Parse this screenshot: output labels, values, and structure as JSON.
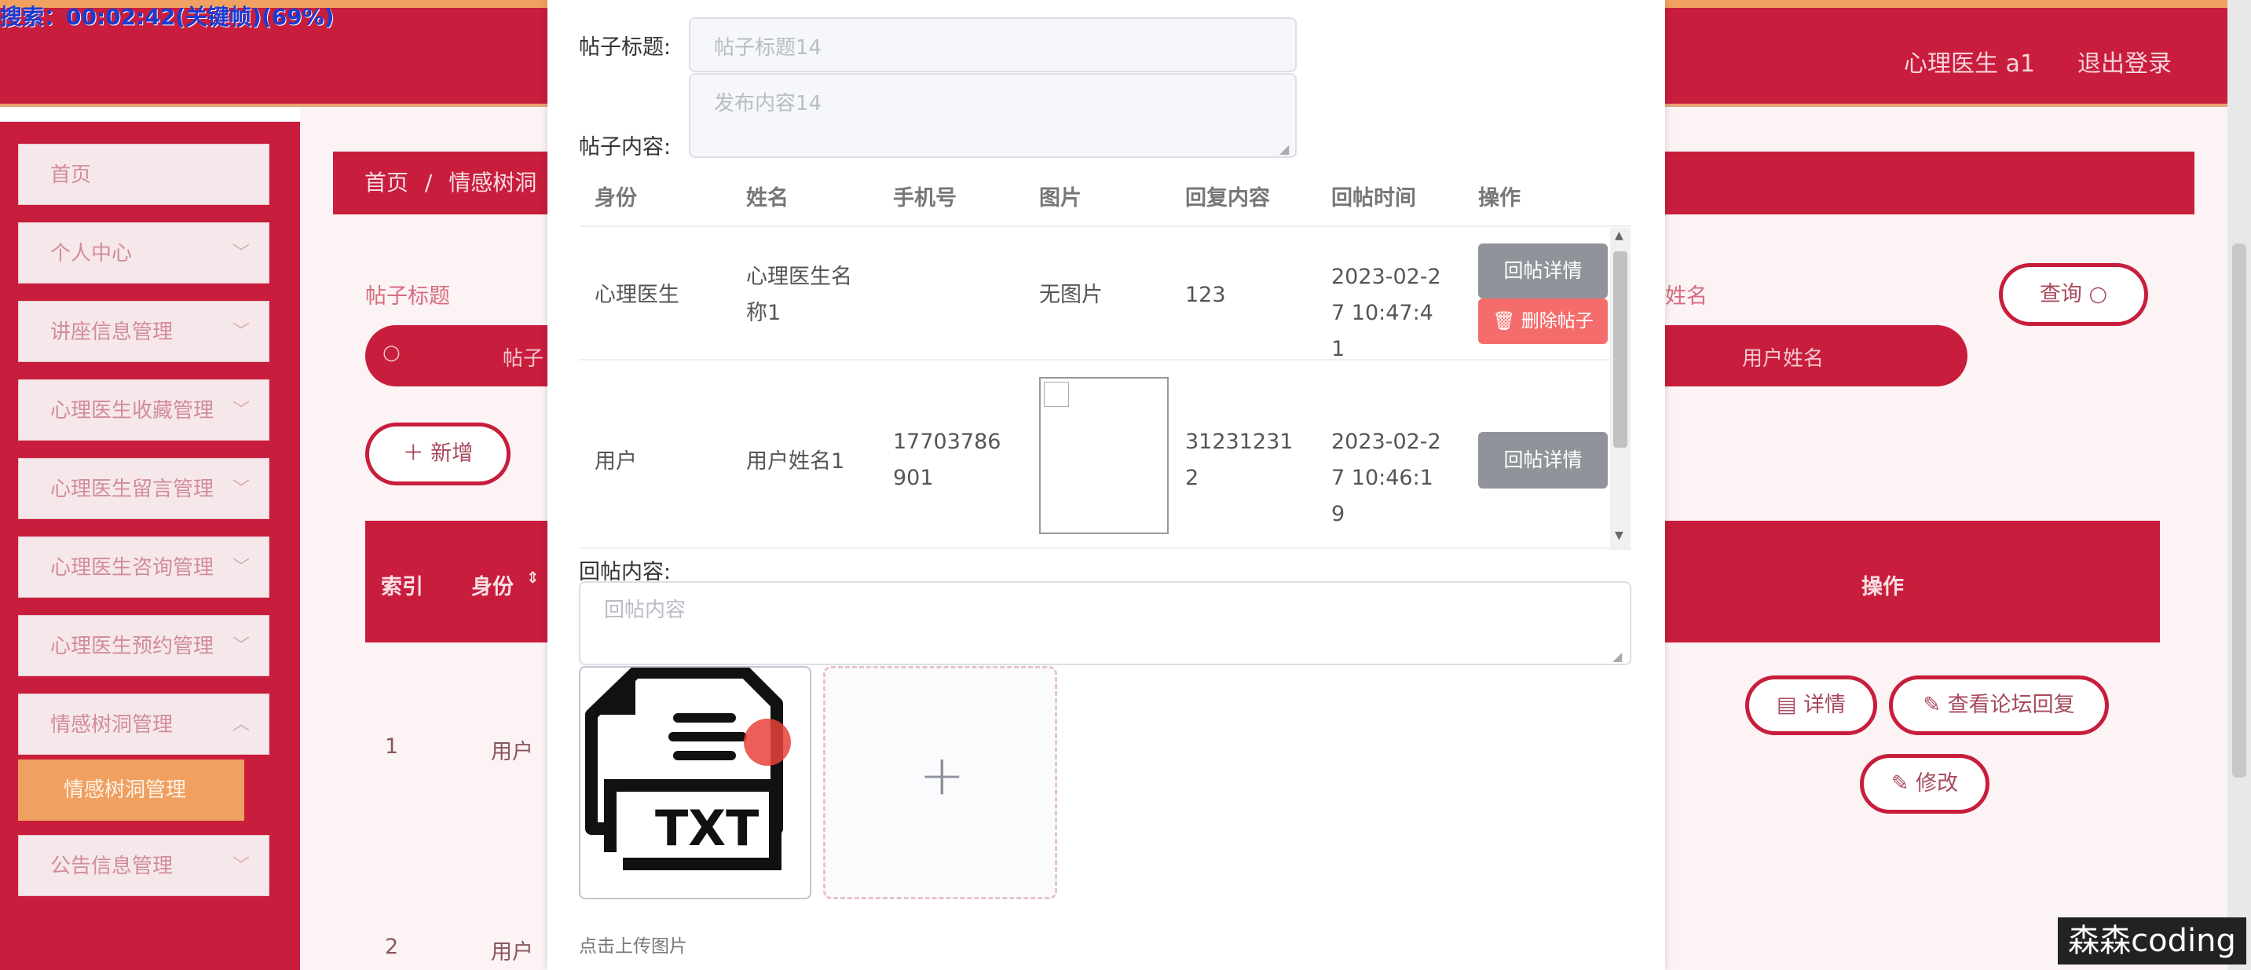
{
  "overlay": {
    "search_status": "搜索：00:02:42(关键帧)(69%)",
    "watermark": "森森coding"
  },
  "header": {
    "user": "心理医生 a1",
    "logout": "退出登录"
  },
  "sidebar": {
    "items": [
      {
        "label": "首页"
      },
      {
        "label": "个人中心"
      },
      {
        "label": "讲座信息管理"
      },
      {
        "label": "心理医生收藏管理"
      },
      {
        "label": "心理医生留言管理"
      },
      {
        "label": "心理医生咨询管理"
      },
      {
        "label": "心理医生预约管理"
      },
      {
        "label": "情感树洞管理"
      },
      {
        "label": "公告信息管理"
      }
    ],
    "active_sub": "情感树洞管理"
  },
  "main": {
    "breadcrumb_home": "首页",
    "breadcrumb_sep": "/",
    "breadcrumb_current": "情感树洞",
    "filter_title_label": "帖子标题",
    "filter_title_placeholder": "帖子",
    "filter_name_suffix": "姓名",
    "filter_name_placeholder": "用户姓名",
    "query_button": "查询",
    "add_button": "新增",
    "col_index": "索引",
    "col_identity": "身份",
    "col_actions": "操作",
    "rows": [
      {
        "index": "1",
        "identity": "用户"
      },
      {
        "index": "2",
        "identity": "用户"
      }
    ],
    "detail_button": "详情",
    "forum_reply_button": "查看论坛回复",
    "edit_button": "修改"
  },
  "dialog": {
    "title_label": "帖子标题:",
    "title_value": "帖子标题14",
    "content_label": "帖子内容:",
    "content_value": "发布内容14",
    "table": {
      "headers": [
        "身份",
        "姓名",
        "手机号",
        "图片",
        "回复内容",
        "回帖时间",
        "操作"
      ],
      "rows": [
        {
          "identity": "心理医生",
          "name": "心理医生名称1",
          "phone": "",
          "image": "无图片",
          "reply": "123",
          "time": "2023-02-27 10:47:41",
          "btn_detail": "回帖详情",
          "btn_delete": "删除帖子"
        },
        {
          "identity": "用户",
          "name": "用户姓名1",
          "phone": "17703786901",
          "image": "",
          "reply": "312312312",
          "time": "2023-02-27 10:46:19",
          "btn_detail": "回帖详情"
        }
      ]
    },
    "reply_label": "回帖内容:",
    "reply_placeholder": "回帖内容",
    "upload_file_type": "TXT",
    "upload_hint": "点击上传图片"
  }
}
